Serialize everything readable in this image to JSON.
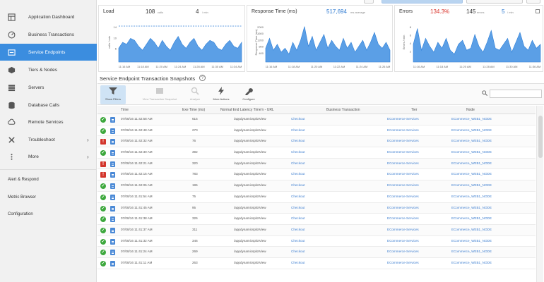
{
  "nav": {
    "items": [
      {
        "label": "Application Dashboard",
        "icon": "dashboard-icon"
      },
      {
        "label": "Business Transactions",
        "icon": "gauge-icon"
      },
      {
        "label": "Service Endpoints",
        "icon": "endpoint-icon"
      },
      {
        "label": "Tiers & Nodes",
        "icon": "cube-icon"
      },
      {
        "label": "Servers",
        "icon": "server-icon"
      },
      {
        "label": "Database Calls",
        "icon": "database-icon"
      },
      {
        "label": "Remote Services",
        "icon": "cloud-icon"
      },
      {
        "label": "Troubleshoot",
        "icon": "tools-icon"
      },
      {
        "label": "More",
        "icon": "more-icon"
      }
    ],
    "active_index": 2,
    "plain": [
      "Alert & Respond",
      "Metric Browser",
      "Configuration"
    ]
  },
  "charts": {
    "load": {
      "title": "Load",
      "value": "108",
      "unit": "calls",
      "value2": "4",
      "unit2": "/ min",
      "ylabel": "calls / min",
      "yticks": [
        "14",
        "10",
        "6"
      ],
      "xticks": [
        "11:16 AM",
        "11:18 AM",
        "11:20 AM",
        "11:24 AM",
        "11:28 AM",
        "11:30 AM",
        "11:34 AM"
      ]
    },
    "response": {
      "title": "Response Time (ms)",
      "value": "517,694",
      "unit": "ms average",
      "ylabel": "Response Time (ms)",
      "yticks": [
        "2000",
        "1600",
        "1200",
        "800",
        "400"
      ],
      "xticks": [
        "11:16 AM",
        "11:18 AM",
        "11:20 AM",
        "11:22 AM",
        "11:24 AM",
        "11:26 AM"
      ]
    },
    "errors": {
      "title": "Errors",
      "value": "134.3%",
      "value2": "145",
      "unit2": "errors",
      "value3": "5",
      "unit3": "/ min",
      "ylabel": "Errors / min",
      "yticks": [
        "8",
        "6",
        "4",
        "2"
      ],
      "xticks": [
        "11:16 AM",
        "11:18 AM",
        "11:20 AM",
        "11:28 AM",
        "11:30 AM",
        "11:36 AM"
      ]
    },
    "colors": {
      "area": "#5b9fe6",
      "stroke": "#2f7fd6",
      "threshold": "#2f7fd6"
    }
  },
  "snapshots": {
    "title": "Service Endpoint Transaction Snapshots",
    "help": "?",
    "toolbar": [
      {
        "label": "Show Filters",
        "icon": "filter-icon"
      },
      {
        "label": "View Transaction Snapshot",
        "icon": "snapshot-icon"
      },
      {
        "label": "Analyze",
        "icon": "analyze-icon"
      },
      {
        "label": "More Actions",
        "icon": "bolt-icon"
      },
      {
        "label": "Configure",
        "icon": "wrench-icon"
      }
    ],
    "columns": [
      "Time",
      "Exe Time (ms)",
      "Normal End Latency Time'n - URL",
      "Business Transaction",
      "Tier",
      "Node"
    ],
    "rows": [
      {
        "status": "ok",
        "time": "07/08/16 11:42:58 AM",
        "exe": "615",
        "url": "/appdynamicsplotView",
        "bt": "Checkout",
        "tier": "ECommerce-Services",
        "node": "ECommerce_WEB1_NODE"
      },
      {
        "status": "ok",
        "time": "07/08/16 11:42:48 AM",
        "exe": "270",
        "url": "/appdynamicsplotView",
        "bt": "Checkout",
        "tier": "ECommerce-Services",
        "node": "ECommerce_WEB1_NODE"
      },
      {
        "status": "err",
        "time": "07/08/16 11:42:32 AM",
        "exe": "76",
        "url": "/appdynamicsplotView",
        "bt": "Checkout",
        "tier": "ECommerce-Services",
        "node": "ECommerce_WEB1_NODE"
      },
      {
        "status": "ok",
        "time": "07/08/16 11:42:30 AM",
        "exe": "392",
        "url": "/appdynamicsplotView",
        "bt": "Checkout",
        "tier": "ECommerce-Services",
        "node": "ECommerce_WEB1_NODE"
      },
      {
        "status": "err",
        "time": "07/08/16 11:42:21 AM",
        "exe": "320",
        "url": "/appdynamicsplotView",
        "bt": "Checkout",
        "tier": "ECommerce-Services",
        "node": "ECommerce_WEB1_NODE"
      },
      {
        "status": "err",
        "time": "07/08/16 11:42:15 AM",
        "exe": "783",
        "url": "/appdynamicsplotView",
        "bt": "Checkout",
        "tier": "ECommerce-Services",
        "node": "ECommerce_WEB1_NODE"
      },
      {
        "status": "ok",
        "time": "07/08/16 11:42:05 AM",
        "exe": "195",
        "url": "/appdynamicsplotView",
        "bt": "Checkout",
        "tier": "ECommerce-Services",
        "node": "ECommerce_WEB1_NODE"
      },
      {
        "status": "ok",
        "time": "07/08/16 11:41:54 AM",
        "exe": "75",
        "url": "/appdynamicsplotView",
        "bt": "Checkout",
        "tier": "ECommerce-Services",
        "node": "ECommerce_WEB1_NODE"
      },
      {
        "status": "ok",
        "time": "07/08/16 11:41:45 AM",
        "exe": "95",
        "url": "/appdynamicsplotView",
        "bt": "Checkout",
        "tier": "ECommerce-Services",
        "node": "ECommerce_WEB1_NODE"
      },
      {
        "status": "ok",
        "time": "07/08/16 11:41:38 AM",
        "exe": "326",
        "url": "/appdynamicsplotView",
        "bt": "Checkout",
        "tier": "ECommerce-Services",
        "node": "ECommerce_WEB1_NODE"
      },
      {
        "status": "ok",
        "time": "07/08/16 11:41:37 AM",
        "exe": "311",
        "url": "/appdynamicsplotView",
        "bt": "Checkout",
        "tier": "ECommerce-Services",
        "node": "ECommerce_WEB1_NODE"
      },
      {
        "status": "ok",
        "time": "07/08/16 11:41:32 AM",
        "exe": "346",
        "url": "/appdynamicsplotView",
        "bt": "Checkout",
        "tier": "ECommerce-Services",
        "node": "ECommerce_WEB1_NODE"
      },
      {
        "status": "ok",
        "time": "07/08/16 11:41:24 AM",
        "exe": "269",
        "url": "/appdynamicsplotView",
        "bt": "Checkout",
        "tier": "ECommerce-Services",
        "node": "ECommerce_WEB1_NODE"
      },
      {
        "status": "ok",
        "time": "07/08/16 11:41:11 AM",
        "exe": "263",
        "url": "/appdynamicsplotView",
        "bt": "Checkout",
        "tier": "ECommerce-Services",
        "node": "ECommerce_WEB1_NODE"
      }
    ]
  }
}
